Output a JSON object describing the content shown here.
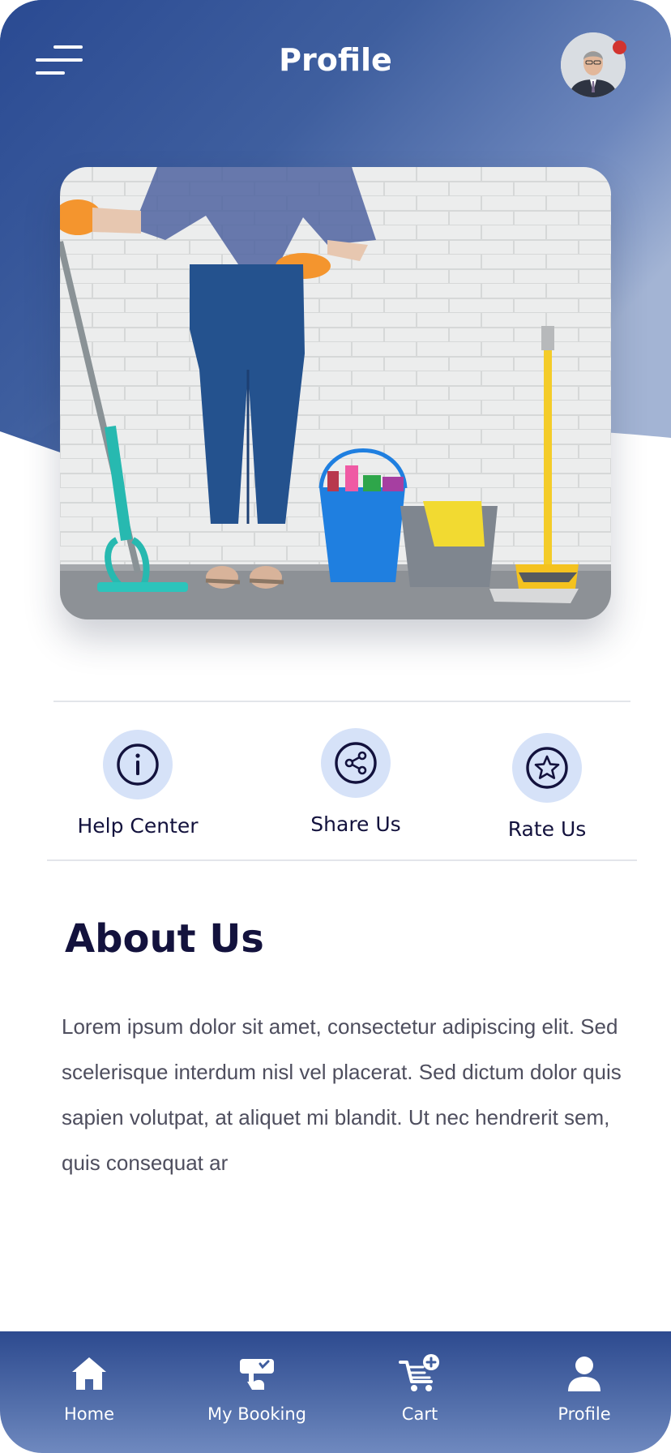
{
  "header": {
    "title": "Profile"
  },
  "actions": [
    {
      "label": "Help Center",
      "icon": "info-icon"
    },
    {
      "label": "Share Us",
      "icon": "share-icon"
    },
    {
      "label": "Rate Us",
      "icon": "star-icon"
    }
  ],
  "about": {
    "title": "About Us",
    "body": "Lorem ipsum dolor sit amet, consectetur adipiscing elit. Sed scelerisque interdum nisl vel placerat. Sed dictum dolor quis sapien volutpat, at aliquet mi blandit. Ut nec hendrerit sem, quis consequat ar"
  },
  "bottom_nav": [
    {
      "label": "Home",
      "icon": "home-icon"
    },
    {
      "label": "My Booking",
      "icon": "booking-icon"
    },
    {
      "label": "Cart",
      "icon": "cart-add-icon"
    },
    {
      "label": "Profile",
      "icon": "user-icon"
    }
  ],
  "colors": {
    "primary": "#2d4a8f",
    "accent_light": "#d6e2f8",
    "heading": "#13123d",
    "notification": "#d2342f"
  }
}
